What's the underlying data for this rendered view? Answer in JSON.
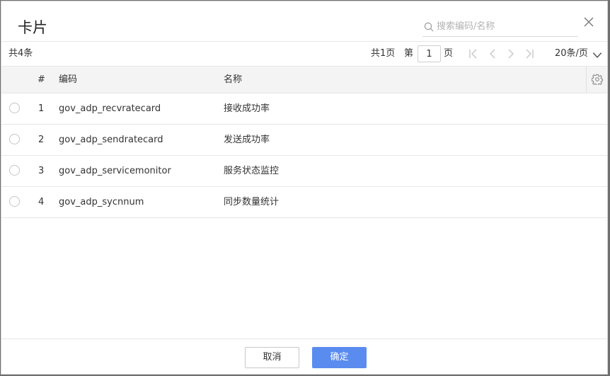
{
  "dialog": {
    "title": "卡片",
    "search_placeholder": "搜索编码/名称",
    "icons": {
      "search": "search-icon",
      "close": "close-icon",
      "settings": "gear-icon"
    }
  },
  "pagination": {
    "total_label": "共4条",
    "total_pages_label": "共1页",
    "page_prefix": "第",
    "current_page": "1",
    "page_suffix": "页",
    "page_size_label": "20条/页"
  },
  "table": {
    "columns": [
      "#",
      "编码",
      "名称"
    ],
    "rows": [
      {
        "index": "1",
        "code": "gov_adp_recvratecard",
        "name": "接收成功率"
      },
      {
        "index": "2",
        "code": "gov_adp_sendratecard",
        "name": "发送成功率"
      },
      {
        "index": "3",
        "code": "gov_adp_servicemonitor",
        "name": "服务状态监控"
      },
      {
        "index": "4",
        "code": "gov_adp_sycnnum",
        "name": "同步数量统计"
      }
    ]
  },
  "footer": {
    "cancel_label": "取消",
    "ok_label": "确定"
  },
  "colors": {
    "primary": "#5a8cf0",
    "header_bg": "#f4f4f4",
    "border": "#e6e6e6"
  }
}
